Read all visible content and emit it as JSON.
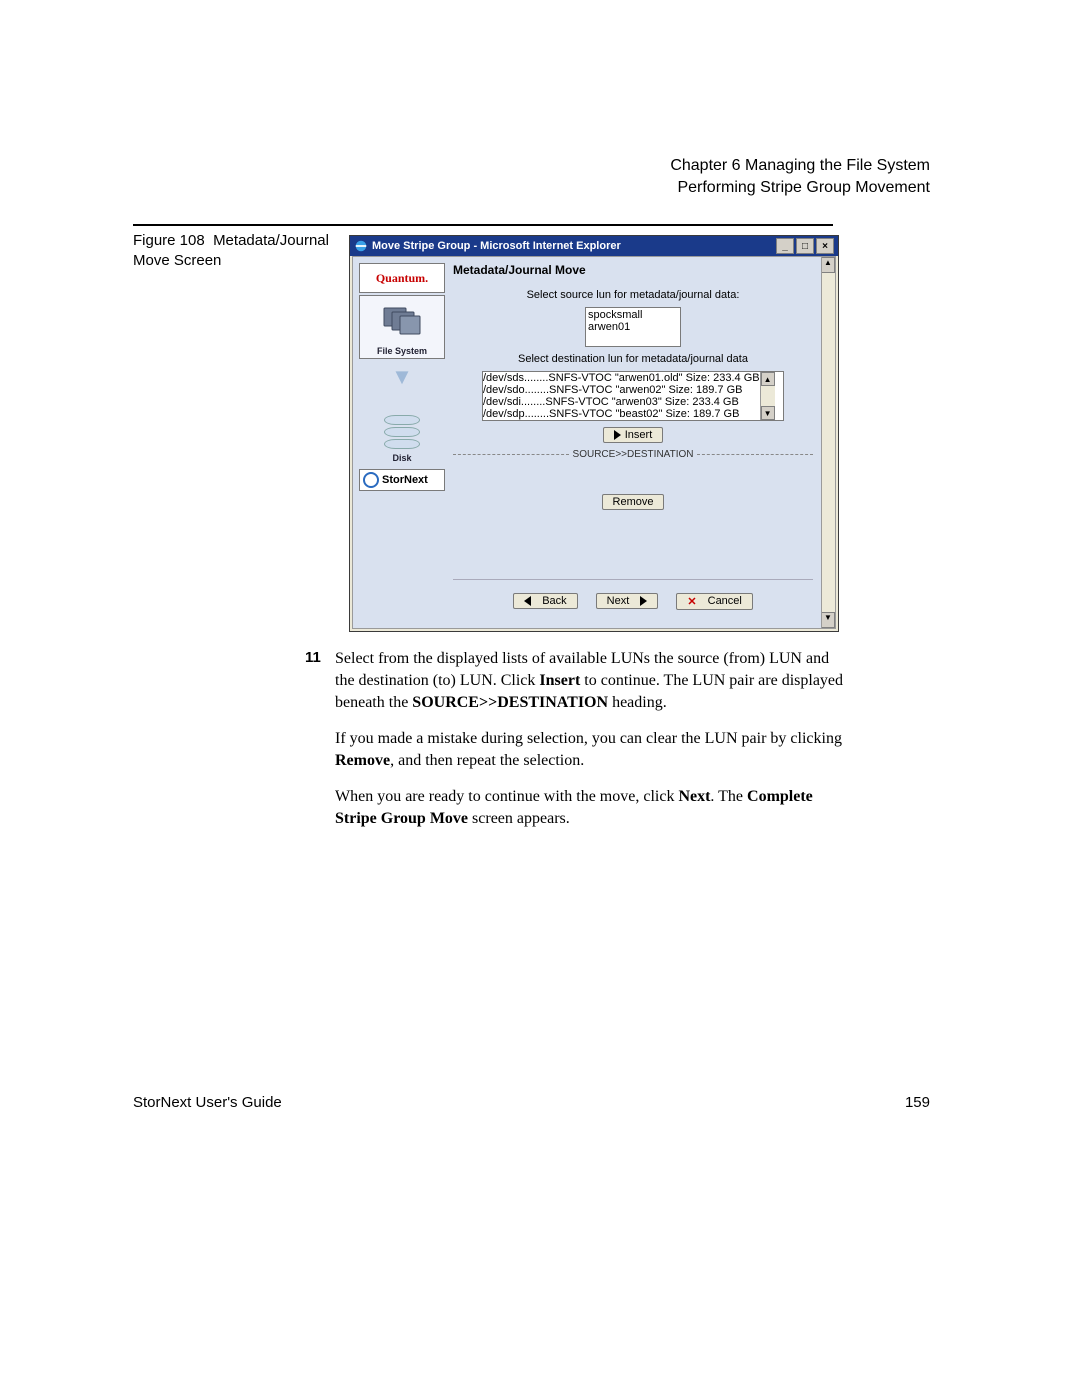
{
  "header": {
    "chapter": "Chapter 6  Managing the File System",
    "section": "Performing Stripe Group Movement"
  },
  "figure": {
    "caption_prefix": "Figure 108",
    "caption": "Metadata/Journal Move Screen"
  },
  "browser": {
    "title": "Move Stripe Group - Microsoft Internet Explorer",
    "win": {
      "min": "_",
      "max": "□",
      "close": "×"
    }
  },
  "sidebar": {
    "brand": "Quantum.",
    "fs_label": "File System",
    "disk_label": "Disk",
    "product": "StorNext"
  },
  "panel": {
    "title": "Metadata/Journal Move",
    "source_label": "Select source lun for metadata/journal data:",
    "source_options": [
      "spocksmall",
      "arwen01"
    ],
    "dest_label": "Select destination lun for metadata/journal data",
    "dest_options": [
      "/dev/sds........SNFS-VTOC \"arwen01.old\" Size: 233.4 GB",
      "/dev/sdo........SNFS-VTOC \"arwen02\" Size: 189.7 GB",
      "/dev/sdi........SNFS-VTOC \"arwen03\" Size: 233.4 GB",
      "/dev/sdp........SNFS-VTOC \"beast02\" Size: 189.7 GB"
    ],
    "insert": "Insert",
    "sd_divider": "SOURCE>>DESTINATION",
    "remove": "Remove",
    "back": "Back",
    "next": "Next",
    "cancel": "Cancel"
  },
  "step": {
    "num": "11",
    "p1a": "Select from the displayed lists of available LUNs the source (from) LUN and the destination (to) LUN. Click ",
    "p1b": "Insert",
    "p1c": " to continue. The LUN pair are displayed beneath the ",
    "p1d": "SOURCE>>DESTINATION",
    "p1e": " heading.",
    "p2a": "If you made a mistake during selection, you can clear the LUN pair by clicking ",
    "p2b": "Remove",
    "p2c": ", and then repeat the selection.",
    "p3a": "When you are ready to continue with the move, click ",
    "p3b": "Next",
    "p3c": ". The ",
    "p3d": "Complete Stripe Group Move",
    "p3e": " screen appears."
  },
  "footer": {
    "left": "StorNext User's Guide",
    "right": "159"
  }
}
